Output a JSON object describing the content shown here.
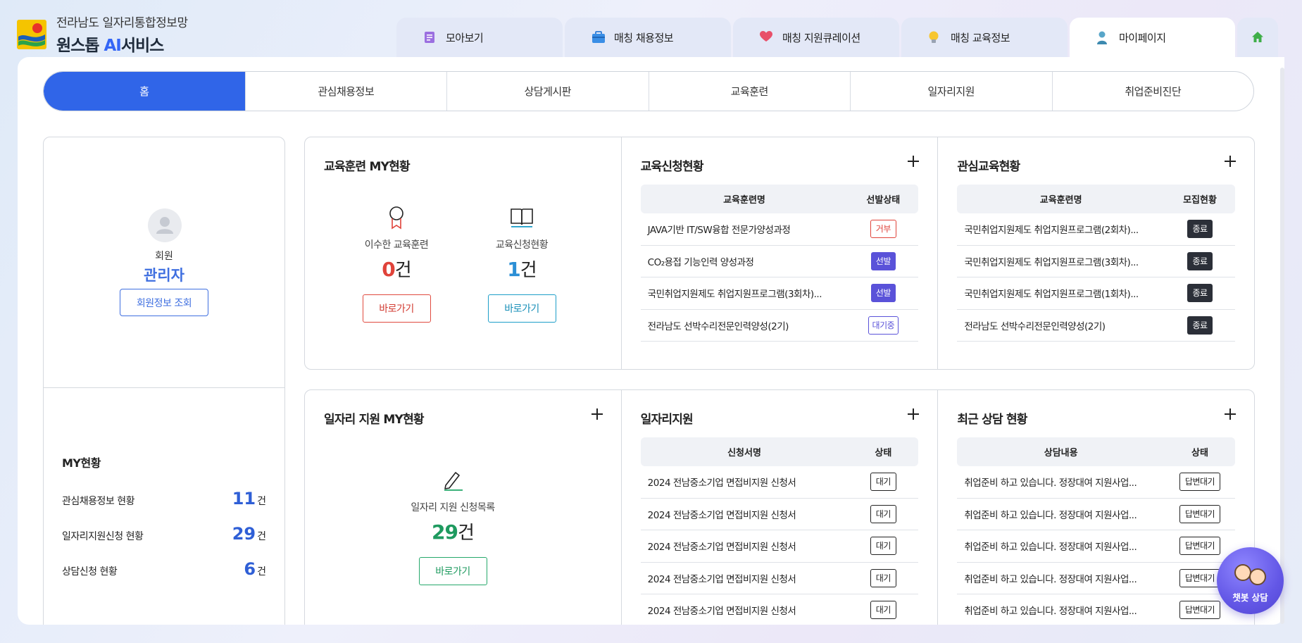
{
  "header": {
    "subtitle": "전라남도 일자리통합정보망",
    "title_prefix": "원스톱 ",
    "title_ai": "AI",
    "title_suffix": "서비스"
  },
  "top_tabs": [
    {
      "label": "모아보기",
      "icon": "document-icon"
    },
    {
      "label": "매칭 채용정보",
      "icon": "briefcase-icon"
    },
    {
      "label": "매칭 지원큐레이션",
      "icon": "heart-icon"
    },
    {
      "label": "매칭 교육정보",
      "icon": "lightbulb-icon"
    },
    {
      "label": "마이페이지",
      "icon": "person-icon",
      "active": true
    }
  ],
  "subnav": [
    "홈",
    "관심채용정보",
    "상담게시판",
    "교육훈련",
    "일자리지원",
    "취업준비진단"
  ],
  "profile": {
    "role": "회원",
    "name": "관리자",
    "button": "회원정보 조회"
  },
  "my_status": {
    "title": "MY현황",
    "rows": [
      {
        "label": "관심채용정보 현황",
        "value": "11",
        "unit": "건"
      },
      {
        "label": "일자리지원신청 현황",
        "value": "29",
        "unit": "건"
      },
      {
        "label": "상담신청 현황",
        "value": "6",
        "unit": "건"
      }
    ]
  },
  "edu_my": {
    "title": "교육훈련 MY현황",
    "completed": {
      "label": "이수한 교육훈련",
      "value": "0",
      "unit": "건",
      "button": "바로가기"
    },
    "applied": {
      "label": "교육신청현황",
      "value": "1",
      "unit": "건",
      "button": "바로가기"
    }
  },
  "edu_apply": {
    "title": "교육신청현황",
    "headers": [
      "교육훈련명",
      "선발상태"
    ],
    "rows": [
      {
        "name": "JAVA기반 IT/SW융합 전문가양성과정",
        "status": "거부"
      },
      {
        "name": "CO₂용접 기능인력 양성과정",
        "status": "선발"
      },
      {
        "name": "국민취업지원제도 취업지원프로그램(3회차)...",
        "status": "선발"
      },
      {
        "name": "전라남도 선박수리전문인력양성(2기)",
        "status": "대기중"
      }
    ]
  },
  "edu_interest": {
    "title": "관심교육현황",
    "headers": [
      "교육훈련명",
      "모집현황"
    ],
    "rows": [
      {
        "name": "국민취업지원제도 취업지원프로그램(2회차)...",
        "status": "종료"
      },
      {
        "name": "국민취업지원제도 취업지원프로그램(3회차)...",
        "status": "종료"
      },
      {
        "name": "국민취업지원제도 취업지원프로그램(1회차)...",
        "status": "종료"
      },
      {
        "name": "전라남도 선박수리전문인력양성(2기)",
        "status": "종료"
      }
    ]
  },
  "job_my": {
    "title": "일자리 지원 MY현황",
    "label": "일자리 지원 신청목록",
    "value": "29",
    "unit": "건",
    "button": "바로가기"
  },
  "job_support": {
    "title": "일자리지원",
    "headers": [
      "신청서명",
      "상태"
    ],
    "rows": [
      {
        "name": "2024 전남중소기업 면접비지원 신청서",
        "status": "대기"
      },
      {
        "name": "2024 전남중소기업 면접비지원 신청서",
        "status": "대기"
      },
      {
        "name": "2024 전남중소기업 면접비지원 신청서",
        "status": "대기"
      },
      {
        "name": "2024 전남중소기업 면접비지원 신청서",
        "status": "대기"
      },
      {
        "name": "2024 전남중소기업 면접비지원 신청서",
        "status": "대기"
      }
    ]
  },
  "consult": {
    "title": "최근 상담 현황",
    "headers": [
      "상담내용",
      "상태"
    ],
    "rows": [
      {
        "name": "취업준비 하고 있습니다. 정장대여 지원사업...",
        "status": "답변대기"
      },
      {
        "name": "취업준비 하고 있습니다. 정장대여 지원사업...",
        "status": "답변대기"
      },
      {
        "name": "취업준비 하고 있습니다. 정장대여 지원사업...",
        "status": "답변대기"
      },
      {
        "name": "취업준비 하고 있습니다. 정장대여 지원사업...",
        "status": "답변대기"
      },
      {
        "name": "취업준비 하고 있습니다. 정장대여 지원사업...",
        "status": "답변대기"
      }
    ]
  },
  "chatbot": {
    "label": "챗봇 상담"
  },
  "colors": {
    "primary": "#3065e8",
    "badge_reject": "#e0433a",
    "badge_select": "#5a52d9",
    "badge_end": "#2b2f38",
    "count_red": "#e0433a",
    "count_blue": "#2b8fd6",
    "count_green": "#1e9a5f"
  }
}
